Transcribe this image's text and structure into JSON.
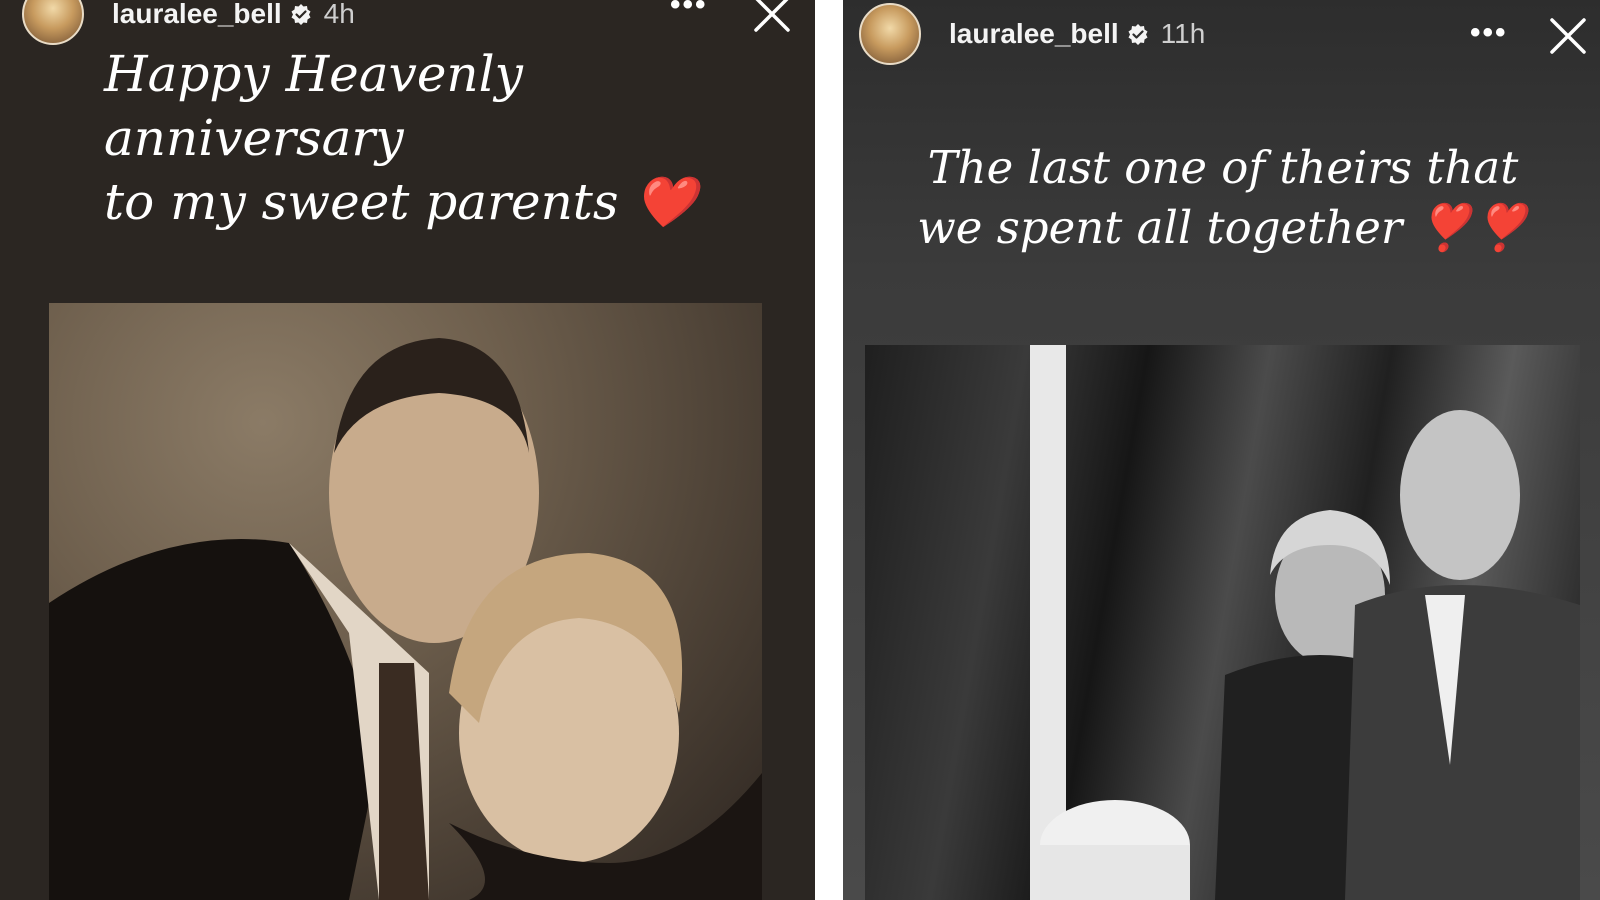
{
  "stories": [
    {
      "username": "lauralee_bell",
      "time": "4h",
      "more": "•••",
      "caption_lines": [
        "Happy Heavenly",
        "anniversary",
        "to my sweet parents ❤️"
      ]
    },
    {
      "username": "lauralee_bell",
      "time": "11h",
      "more": "•••",
      "caption_lines": [
        "The last one of theirs that",
        "we spent all together ❣️❣️"
      ]
    }
  ],
  "colors": {
    "left_story_bg": "#2b2622",
    "right_story_bg": "#3b3b3b",
    "text": "#ffffff",
    "heart": "#e0242c"
  },
  "icons": {
    "verified": "verified-badge-icon",
    "more": "more-options-icon",
    "close": "close-icon"
  }
}
